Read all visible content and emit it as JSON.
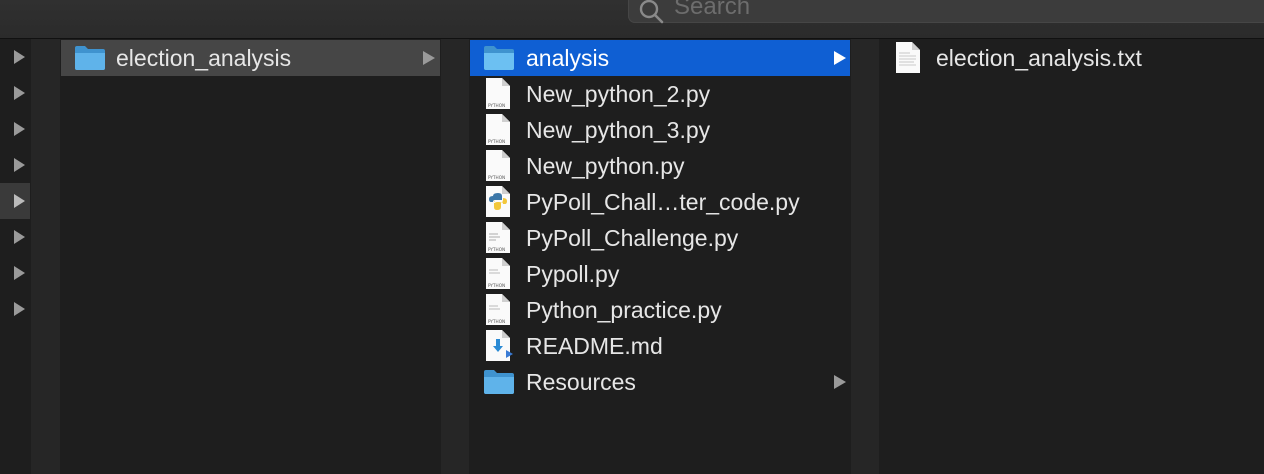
{
  "search": {
    "placeholder": "Search"
  },
  "column1": {
    "items": [
      {
        "label": "election_analysis",
        "icon": "folder-icon"
      }
    ]
  },
  "column2": {
    "items": [
      {
        "label": "analysis",
        "icon": "folder-icon"
      },
      {
        "label": "New_python_2.py",
        "icon": "python-file-icon"
      },
      {
        "label": "New_python_3.py",
        "icon": "python-file-icon"
      },
      {
        "label": "New_python.py",
        "icon": "python-file-icon"
      },
      {
        "label": "PyPoll_Chall…ter_code.py",
        "icon": "python-logo-file-icon"
      },
      {
        "label": "PyPoll_Challenge.py",
        "icon": "python-file-icon"
      },
      {
        "label": "Pypoll.py",
        "icon": "python-file-icon"
      },
      {
        "label": "Python_practice.py",
        "icon": "python-file-icon"
      },
      {
        "label": "README.md",
        "icon": "markdown-file-icon"
      },
      {
        "label": "Resources",
        "icon": "folder-icon"
      }
    ]
  },
  "column3": {
    "items": [
      {
        "label": "election_analysis.txt",
        "icon": "text-file-icon"
      }
    ]
  },
  "icon_labels": {
    "python_badge": "PYTHON"
  },
  "colors": {
    "selection_blue": "#0f5fd3",
    "selection_gray": "#464646",
    "folder": "#5aaee4",
    "background": "#1e1e1e"
  }
}
